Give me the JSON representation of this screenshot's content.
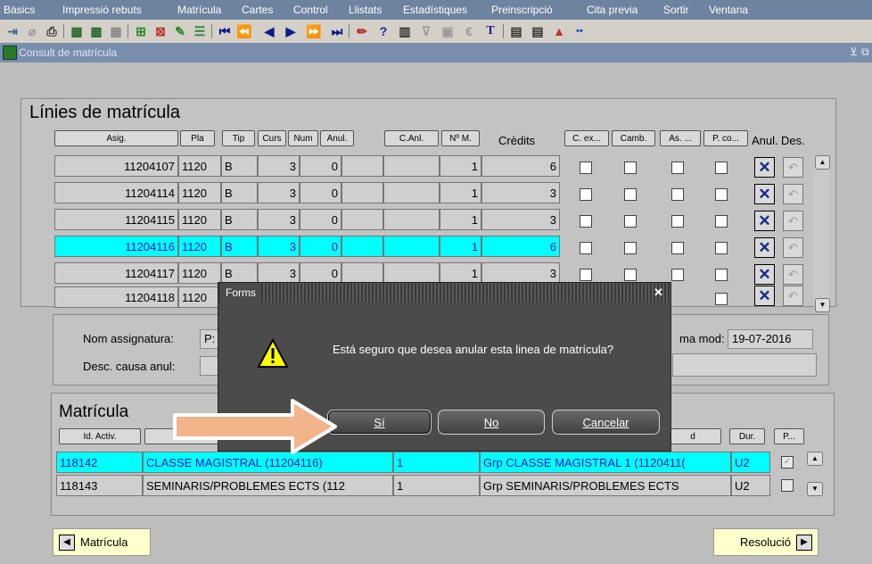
{
  "menu": [
    "Bàsics",
    "Impressió rebuts",
    "Matrícula",
    "Cartes",
    "Control",
    "Llistats",
    "Estadístiques",
    "Preinscripció",
    "Cita previa",
    "Sortir",
    "Ventana"
  ],
  "window": {
    "title": "Consult de matrícula"
  },
  "lines": {
    "title": "Línies de matrícula",
    "headers": [
      "Asig.",
      "Pla",
      "Tip",
      "Curs",
      "Num",
      "Anul.",
      "C.Anl.",
      "Nº M.",
      "Crèdits",
      "C. ex...",
      "Camb.",
      "As. ...",
      "P. co...",
      "Anul.",
      "Des."
    ],
    "rows": [
      {
        "asig": "11204107",
        "pla": "1120",
        "tip": "B",
        "curs": "3",
        "num": "0",
        "nm": "1",
        "credits": "6"
      },
      {
        "asig": "11204114",
        "pla": "1120",
        "tip": "B",
        "curs": "3",
        "num": "0",
        "nm": "1",
        "credits": "3"
      },
      {
        "asig": "11204115",
        "pla": "1120",
        "tip": "B",
        "curs": "3",
        "num": "0",
        "nm": "1",
        "credits": "3"
      },
      {
        "asig": "11204116",
        "pla": "1120",
        "tip": "B",
        "curs": "3",
        "num": "0",
        "nm": "1",
        "credits": "6"
      },
      {
        "asig": "11204117",
        "pla": "1120",
        "tip": "B",
        "curs": "3",
        "num": "0",
        "nm": "1",
        "credits": "3"
      },
      {
        "asig": "11204118",
        "pla": "1120",
        "tip": "",
        "curs": "",
        "num": "",
        "nm": "",
        "credits": ""
      }
    ],
    "selected_row": 3
  },
  "detail": {
    "nom_label": "Nom assignatura:",
    "nom_value": "P:",
    "desc_label": "Desc. causa anul:",
    "fecha_label": "ma mod:",
    "fecha_value": "19-07-2016"
  },
  "matricula": {
    "title": "Matrícula",
    "headers": [
      "Id. Activ.",
      "",
      "d",
      "Dur.",
      "P..."
    ],
    "rows": [
      {
        "id": "118142",
        "desc": "CLASSE MAGISTRAL (11204116)",
        "n": "1",
        "grp": "Grp CLASSE MAGISTRAL 1 (1120411(",
        "dur": "U2"
      },
      {
        "id": "118143",
        "desc": "SEMINARIS/PROBLEMES ECTS (112",
        "n": "1",
        "grp": "Grp SEMINARIS/PROBLEMES ECTS",
        "dur": "U2"
      }
    ]
  },
  "dialog": {
    "title": "Forms",
    "message": "Está seguro que desea anular esta linea de matrícula?",
    "buttons": [
      "Sí",
      "No",
      "Cancelar"
    ]
  },
  "nav": {
    "prev_label": "Matrícula",
    "next_label": "Resolució"
  },
  "colors": {
    "selection": "#00ffff",
    "dialog_bg": "#4b4b4b",
    "menu_bg": "#6e83a0",
    "arrow": "#f2b48a"
  }
}
